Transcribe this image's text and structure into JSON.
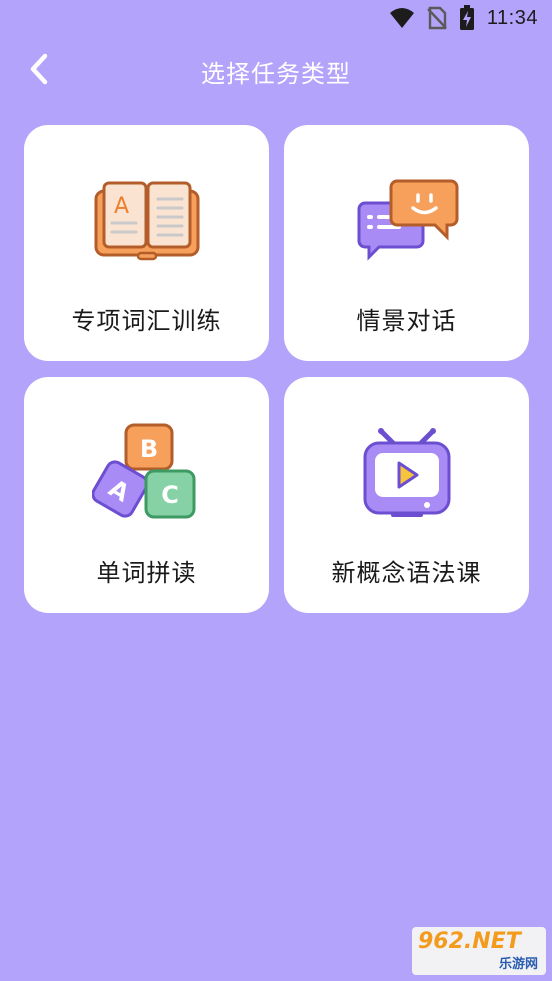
{
  "status_bar": {
    "time": "11:34",
    "icons": [
      "wifi-icon",
      "no-sim-icon",
      "battery-charging-icon"
    ]
  },
  "header": {
    "title": "选择任务类型",
    "back_icon": "chevron-left-icon"
  },
  "colors": {
    "background": "#b4a3fb",
    "card": "#ffffff",
    "orange": "#f7a05c",
    "purple": "#a98bf5",
    "green": "#86d2a6"
  },
  "tasks": [
    {
      "label": "专项词汇训练",
      "icon": "open-book-icon",
      "icon_letter": "A"
    },
    {
      "label": "情景对话",
      "icon": "chat-bubbles-icon"
    },
    {
      "label": "单词拼读",
      "icon": "abc-blocks-icon",
      "icon_letters": [
        "B",
        "A",
        "C"
      ]
    },
    {
      "label": "新概念语法课",
      "icon": "tv-play-icon"
    }
  ],
  "watermark": {
    "brand": "962.NET",
    "sub": "乐游网"
  }
}
